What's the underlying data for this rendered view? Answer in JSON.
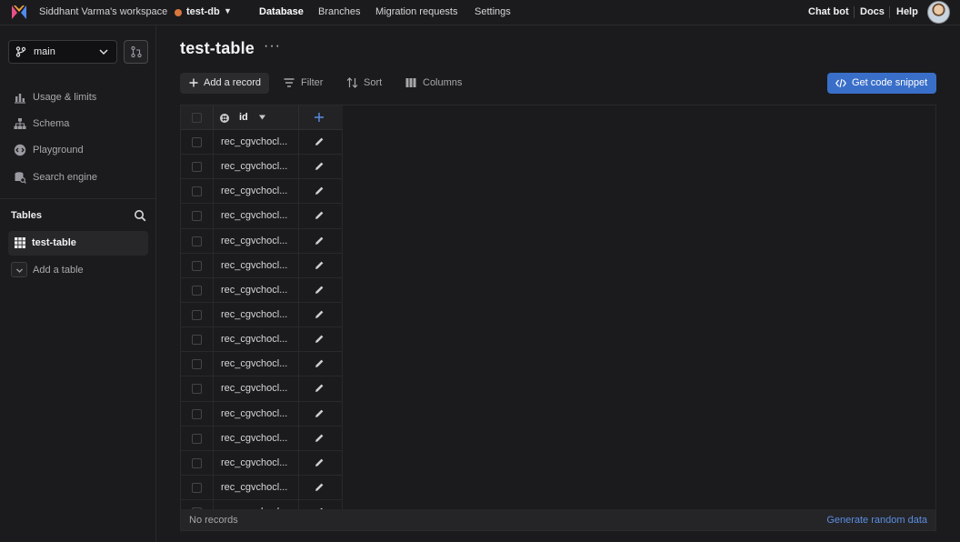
{
  "topbar": {
    "workspace": "Siddhant Varma's workspace",
    "database": "test-db",
    "nav": [
      "Database",
      "Branches",
      "Migration requests",
      "Settings"
    ],
    "active_nav": "Database",
    "right_links": [
      "Chat bot",
      "Docs",
      "Help"
    ]
  },
  "sidebar": {
    "branch": "main",
    "items": [
      "Usage & limits",
      "Schema",
      "Playground",
      "Search engine"
    ],
    "tables_heading": "Tables",
    "active_table": "test-table",
    "add_table": "Add a table"
  },
  "main": {
    "title": "test-table",
    "more": "···",
    "toolbar": {
      "add_record": "Add a record",
      "filter": "Filter",
      "sort": "Sort",
      "columns": "Columns",
      "code_snippet": "Get code snippet"
    },
    "grid": {
      "column_id": "id",
      "rows": [
        "rec_cgvchocl...",
        "rec_cgvchocl...",
        "rec_cgvchocl...",
        "rec_cgvchocl...",
        "rec_cgvchocl...",
        "rec_cgvchocl...",
        "rec_cgvchocl...",
        "rec_cgvchocl...",
        "rec_cgvchocl...",
        "rec_cgvchocl...",
        "rec_cgvchocl...",
        "rec_cgvchocl...",
        "rec_cgvchocl...",
        "rec_cgvchocl...",
        "rec_cgvchocl...",
        "rec_cgvchocl..."
      ]
    },
    "footer": {
      "status": "No records",
      "generate": "Generate random data"
    }
  },
  "colors": {
    "accent": "#3a6fc9",
    "link": "#5b8ee0",
    "db_dot": "#d9773f"
  }
}
